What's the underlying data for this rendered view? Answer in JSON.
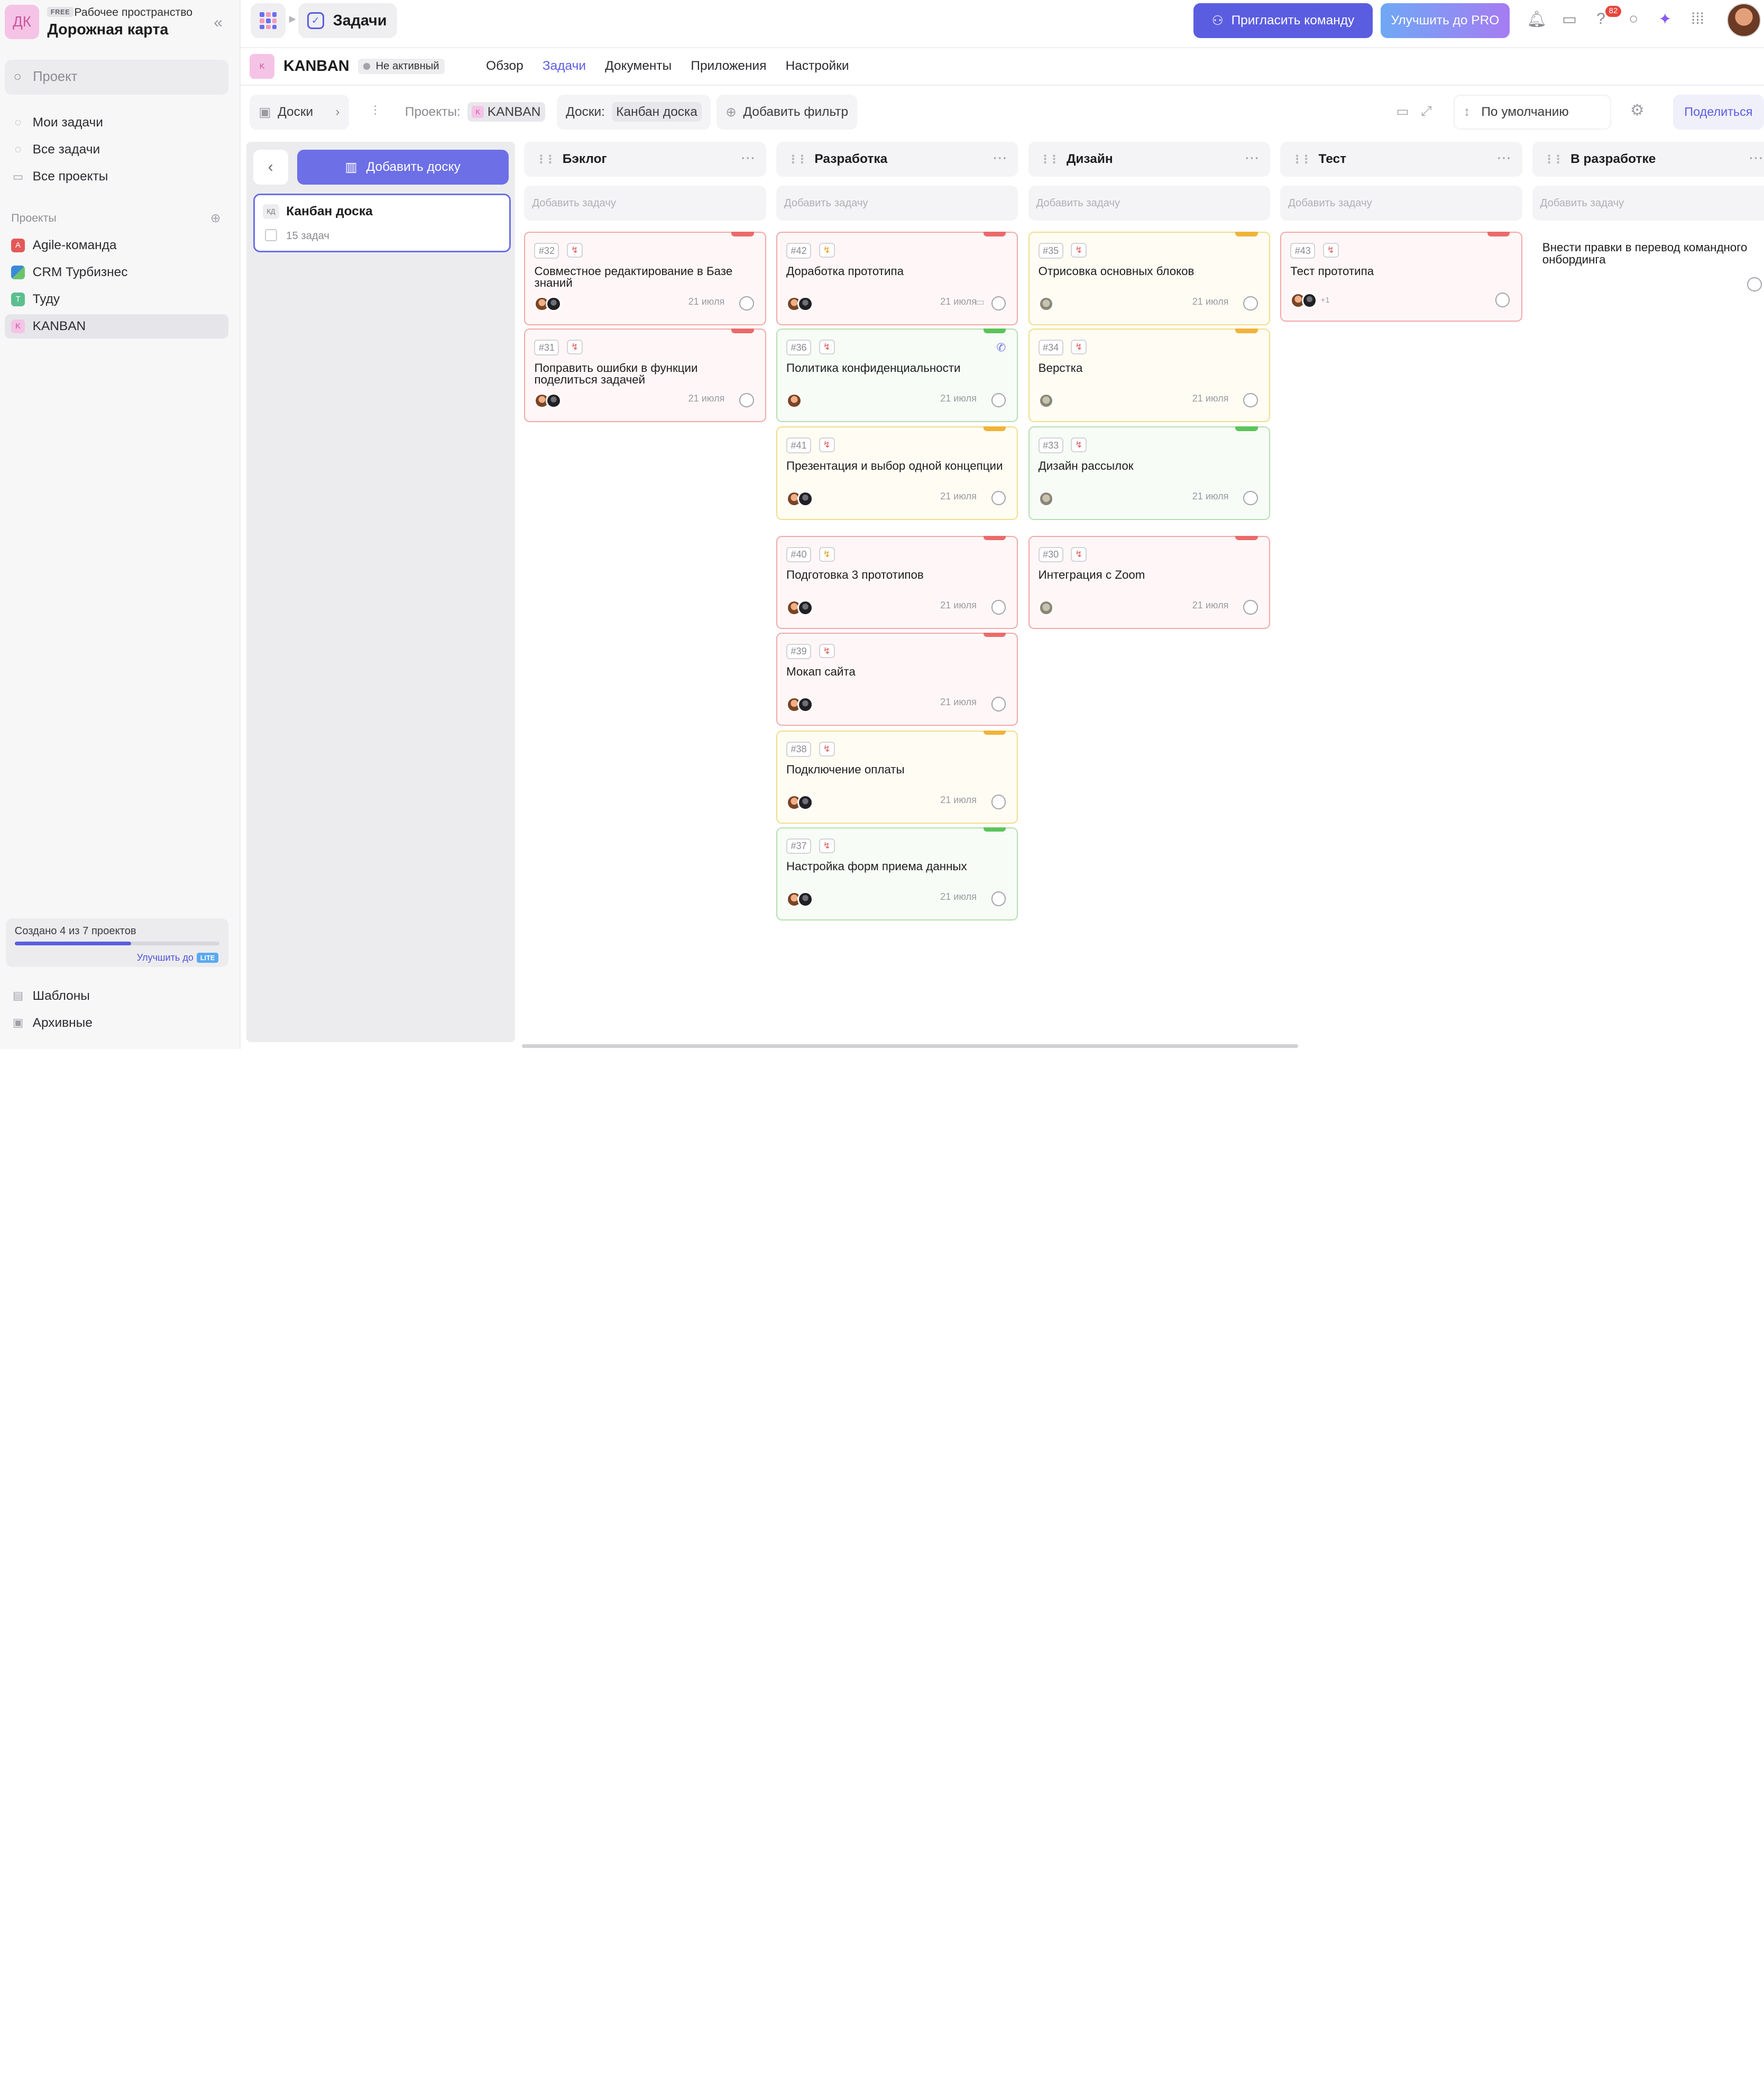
{
  "sidebar": {
    "workspace": {
      "logo": "ДК",
      "plan": "FREE",
      "subtitle": "Рабочее пространство",
      "title": "Дорожная карта"
    },
    "search_placeholder": "Проект",
    "nav": [
      {
        "label": "Мои задачи",
        "icon": "my-tasks-icon"
      },
      {
        "label": "Все задачи",
        "icon": "all-tasks-icon"
      },
      {
        "label": "Все проекты",
        "icon": "folder-icon"
      }
    ],
    "projects_label": "Проекты",
    "projects": [
      {
        "label": "Agile-команда",
        "badge": "A",
        "color": "#e45858"
      },
      {
        "label": "CRM Турбизнес",
        "badge": "",
        "color": "#3b8ad9"
      },
      {
        "label": "Туду",
        "badge": "T",
        "color": "#5cbf8f"
      },
      {
        "label": "KANBAN",
        "badge": "K",
        "color": "#f5c3e6"
      }
    ],
    "limit": {
      "text": "Создано 4 из 7 проектов",
      "progress": 0.57,
      "upgrade": "Улучшить до",
      "tag": "LITE"
    },
    "bottom": [
      {
        "label": "Шаблоны",
        "icon": "templates-icon"
      },
      {
        "label": "Архивные",
        "icon": "archive-icon"
      }
    ]
  },
  "topbar": {
    "crumb": "Задачи",
    "invite": "Пригласить команду",
    "pro": "Улучшить до PRO",
    "notifications": "82"
  },
  "project": {
    "logo": "K",
    "name": "KANBAN",
    "status": "Не активный",
    "tabs": [
      "Обзор",
      "Задачи",
      "Документы",
      "Приложения",
      "Настройки"
    ],
    "active_tab": "Задачи"
  },
  "filters": {
    "boards": "Доски",
    "projects_label": "Проекты:",
    "projects_value": "KANBAN",
    "boards_label": "Доски:",
    "boards_value": "Канбан доска",
    "add_filter": "Добавить фильтр",
    "sort": "По умолчанию",
    "share": "Поделиться"
  },
  "boards_panel": {
    "add_board": "Добавить доску",
    "board": {
      "abbr": "КД",
      "name": "Канбан доска",
      "count": "15 задач"
    }
  },
  "add_task_placeholder": "Добавить задачу",
  "columns": [
    {
      "title": "Бэклог",
      "cards": [
        {
          "id": "#32",
          "title": "Совместное редактирование в Базе знаний",
          "date": "21 июля",
          "color": "red",
          "icon": "r",
          "avatars": [
            "a",
            "b"
          ]
        },
        {
          "id": "#31",
          "title": "Поправить ошибки в функции поделиться задачей",
          "date": "21 июля",
          "color": "red",
          "icon": "r",
          "avatars": [
            "a",
            "b"
          ]
        }
      ]
    },
    {
      "title": "Разработка",
      "cards": [
        {
          "id": "#42",
          "title": "Доработка прототипа",
          "date": "21 июля",
          "color": "red",
          "icon": "y",
          "avatars": [
            "a",
            "b"
          ],
          "comment": true
        },
        {
          "id": "#36",
          "title": "Политика конфиденциальности",
          "date": "21 июля",
          "color": "green",
          "icon": "r",
          "avatars": [
            "a"
          ],
          "call": true
        },
        {
          "id": "#41",
          "title": "Презентация и выбор одной концепции",
          "date": "21 июля",
          "color": "yellow",
          "icon": "r",
          "avatars": [
            "a",
            "b"
          ]
        },
        {
          "id": "#40",
          "title": "Подготовка 3 прототипов",
          "date": "21 июля",
          "color": "red",
          "icon": "y",
          "avatars": [
            "a",
            "b"
          ]
        },
        {
          "id": "#39",
          "title": "Мокап сайта",
          "date": "21 июля",
          "color": "red",
          "icon": "r",
          "avatars": [
            "a",
            "b"
          ]
        },
        {
          "id": "#38",
          "title": "Подключение оплаты",
          "date": "21 июля",
          "color": "yellow",
          "icon": "r",
          "avatars": [
            "a",
            "b"
          ]
        },
        {
          "id": "#37",
          "title": "Настройка форм приема данных",
          "date": "21 июля",
          "color": "green",
          "icon": "r",
          "avatars": [
            "a",
            "b"
          ]
        }
      ]
    },
    {
      "title": "Дизайн",
      "cards": [
        {
          "id": "#35",
          "title": "Отрисовка основных блоков",
          "date": "21 июля",
          "color": "yellow",
          "icon": "r",
          "avatars": [
            "c"
          ]
        },
        {
          "id": "#34",
          "title": "Верстка",
          "date": "21 июля",
          "color": "yellow",
          "icon": "r",
          "avatars": [
            "c"
          ]
        },
        {
          "id": "#33",
          "title": "Дизайн рассылок",
          "date": "21 июля",
          "color": "green",
          "icon": "r",
          "avatars": [
            "c"
          ]
        },
        {
          "id": "#30",
          "title": "Интеграция с Zoom",
          "date": "21 июля",
          "color": "red",
          "icon": "r",
          "avatars": [
            "c"
          ]
        }
      ]
    },
    {
      "title": "Тест",
      "cards": [
        {
          "id": "#43",
          "title": "Тест прототипа",
          "date": "",
          "color": "red",
          "icon": "r",
          "avatars": [
            "a",
            "b"
          ],
          "more": "+1"
        }
      ]
    },
    {
      "title": "В разработке",
      "cards": [
        {
          "id": "",
          "title": "Внести правки в перевод командного онбординга",
          "date": "",
          "color": "white",
          "icon": "",
          "avatars": []
        }
      ]
    }
  ]
}
